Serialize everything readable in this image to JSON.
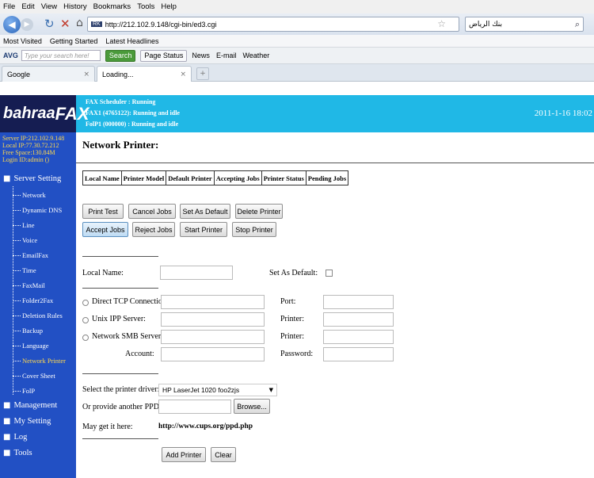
{
  "browser": {
    "menu": [
      "File",
      "Edit",
      "View",
      "History",
      "Bookmarks",
      "Tools",
      "Help"
    ],
    "url": "http://212.102.9.148/cgi-bin/ed3.cgi",
    "site_badge": "RK",
    "search_engine_text": "بنك الرياض",
    "bookmarks": [
      "Most Visited",
      "Getting Started",
      "Latest Headlines"
    ],
    "toolbar": {
      "logo": "AVG",
      "search_placeholder": "Type your search here!",
      "search_button": "Search",
      "page_status": "Page Status",
      "news": "News",
      "email": "E-mail",
      "weather": "Weather"
    },
    "tabs": [
      {
        "label": "Google"
      },
      {
        "label": "Loading..."
      }
    ]
  },
  "header": {
    "logo_main": "bahraa",
    "logo_fax": "FAX",
    "status_lines": [
      "FAX Scheduler : Running",
      "FAX1 (4765122): Running and idle",
      "FolP1 (000000) : Running and idle"
    ],
    "datetime": "2011-1-16 18:02"
  },
  "sidebar": {
    "server_info": [
      "Server IP:212.102.9.148",
      "Local IP:77.30.72.212",
      "Free Space:130.84M",
      "Login ID:admin ()"
    ],
    "server_setting": "Server Setting",
    "items": [
      "Network",
      "Dynamic DNS",
      "Line",
      "Voice",
      "EmailFax",
      "Time",
      "FaxMail",
      "Folder2Fax",
      "Deletion Rules",
      "Backup",
      "Language",
      "Network Printer",
      "Cover Sheet",
      "FolP"
    ],
    "sections": [
      "Management",
      "My Setting",
      "Log",
      "Tools"
    ]
  },
  "content": {
    "title": "Network Printer:",
    "table_headers": [
      "Local Name",
      "Printer Model",
      "Default Printer",
      "Accepting Jobs",
      "Printer Status",
      "Pending Jobs"
    ],
    "buttons_row1": [
      "Print Test",
      "Cancel Jobs",
      "Set As Default",
      "Delete Printer"
    ],
    "buttons_row2": [
      "Accept Jobs",
      "Reject Jobs",
      "Start Printer",
      "Stop Printer"
    ],
    "local_name_label": "Local Name:",
    "set_default_label": "Set As Default:",
    "direct_tcp": "Direct TCP Connection:",
    "unix_ipp": "Unix IPP Server:",
    "network_smb": "Network SMB Server:",
    "account": "Account:",
    "port": "Port:",
    "printer1": "Printer:",
    "printer2": "Printer:",
    "password": "Password:",
    "driver_label": "Select the printer driver:",
    "driver_value": "HP LaserJet 1020 foo2zjs",
    "ppd_label": "Or provide another PPD:",
    "browse": "Browse...",
    "get_it_label": "May get it here:",
    "ppd_url": "http://www.cups.org/ppd.php",
    "add_printer": "Add Printer",
    "clear": "Clear"
  }
}
